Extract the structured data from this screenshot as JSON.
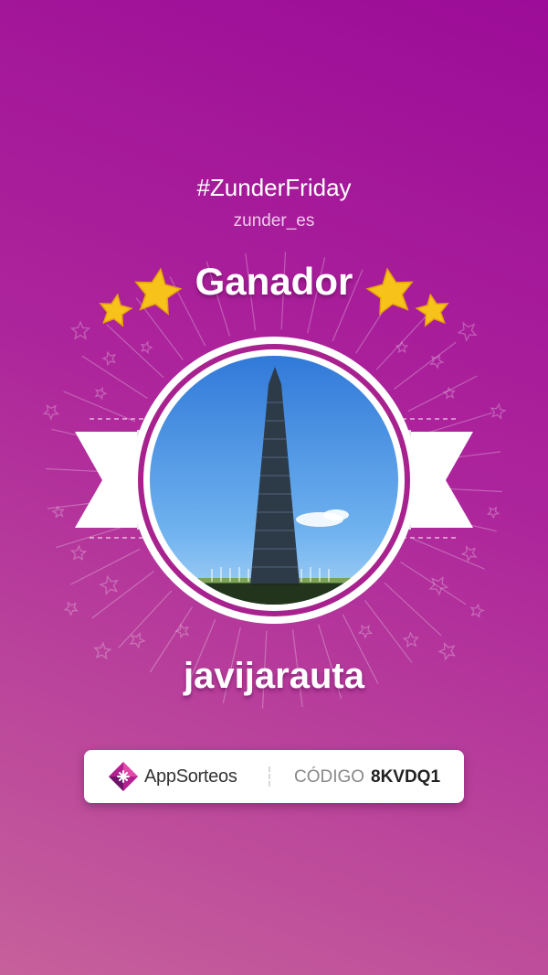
{
  "header": {
    "hashtag": "#ZunderFriday",
    "account": "zunder_es",
    "title": "Ganador"
  },
  "winner": {
    "username": "javijarauta",
    "photo_subject": "washington-monument-photo"
  },
  "footer": {
    "brand_prefix": "App",
    "brand_suffix": "Sorteos",
    "code_label": "CÓDIGO",
    "code_value": "8KVDQ1"
  },
  "colors": {
    "background_top": "#9c0c98",
    "background_bottom": "#c6609b",
    "star_gold": "#f7c21a",
    "ring": "#a8228f"
  }
}
